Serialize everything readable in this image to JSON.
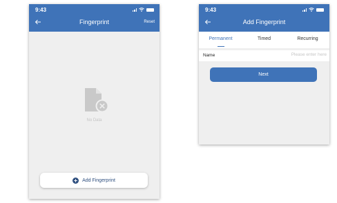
{
  "left_screen": {
    "status_time": "9:43",
    "title": "Fingerprint",
    "reset_label": "Reset",
    "empty_text": "No Data",
    "add_button_label": "Add Fingerprint",
    "icons": {
      "back": "back-arrow-icon",
      "empty": "empty-document-icon",
      "add": "plus-circle-icon"
    }
  },
  "right_screen": {
    "status_time": "9:43",
    "title": "Add Fingerprint",
    "tabs": [
      {
        "label": "Permanent",
        "active": true
      },
      {
        "label": "Timed",
        "active": false
      },
      {
        "label": "Recurring",
        "active": false
      }
    ],
    "name_label": "Name",
    "name_placeholder": "Please enter here",
    "next_label": "Next"
  },
  "colors": {
    "primary": "#3f73b8",
    "background": "#efefef",
    "empty_icon": "#c9c9c9"
  }
}
